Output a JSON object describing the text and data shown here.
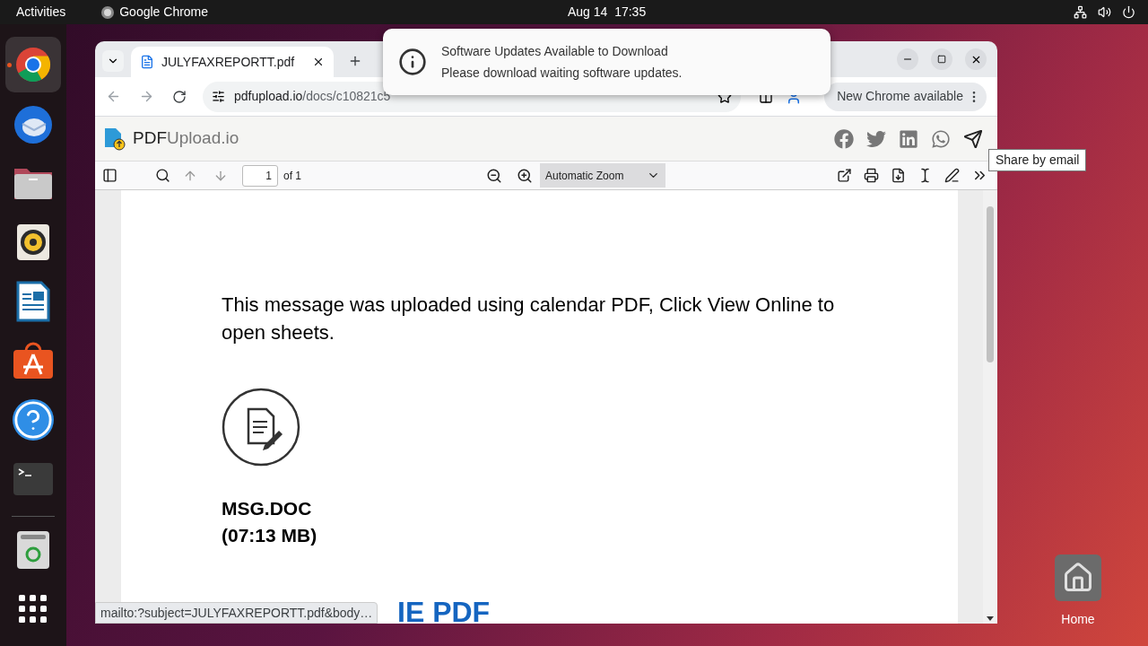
{
  "top_bar": {
    "activities": "Activities",
    "app_name": "Google Chrome",
    "datetime": "Aug 14  17:35"
  },
  "dock": [
    {
      "kind": "chrome",
      "running": true
    },
    {
      "kind": "mail",
      "running": false
    },
    {
      "kind": "files",
      "running": false
    },
    {
      "kind": "music",
      "running": false
    },
    {
      "kind": "writer",
      "running": false
    },
    {
      "kind": "store",
      "running": false
    },
    {
      "kind": "help",
      "running": false
    },
    {
      "kind": "terminal",
      "running": false
    },
    {
      "kind": "trash",
      "running": false
    },
    {
      "kind": "apps",
      "running": false
    }
  ],
  "browser": {
    "tab": {
      "title": "JULYFAXREPORTT.pdf"
    },
    "url": {
      "host": "pdfupload.io",
      "path": "/docs/c10821c5"
    },
    "update_chip": "New Chrome available"
  },
  "site": {
    "logo_bold": "PDF",
    "logo_rest": "Upload.io"
  },
  "pdf_toolbar": {
    "page": "1",
    "page_count": "of 1",
    "zoom": "Automatic Zoom"
  },
  "document": {
    "message": "This message was uploaded using calendar PDF, Click View Online to open sheets.",
    "file_name": "MSG.DOC",
    "file_size": "(07:13 MB)",
    "link": "IE PDF"
  },
  "notification": {
    "title": "Software Updates Available to Download",
    "body": "Please download waiting software updates."
  },
  "tooltip": "Share by email",
  "status_url": "mailto:?subject=JULYFAXREPORTT.pdf&body…",
  "desktop_icons": [
    {
      "label": "Home"
    }
  ]
}
